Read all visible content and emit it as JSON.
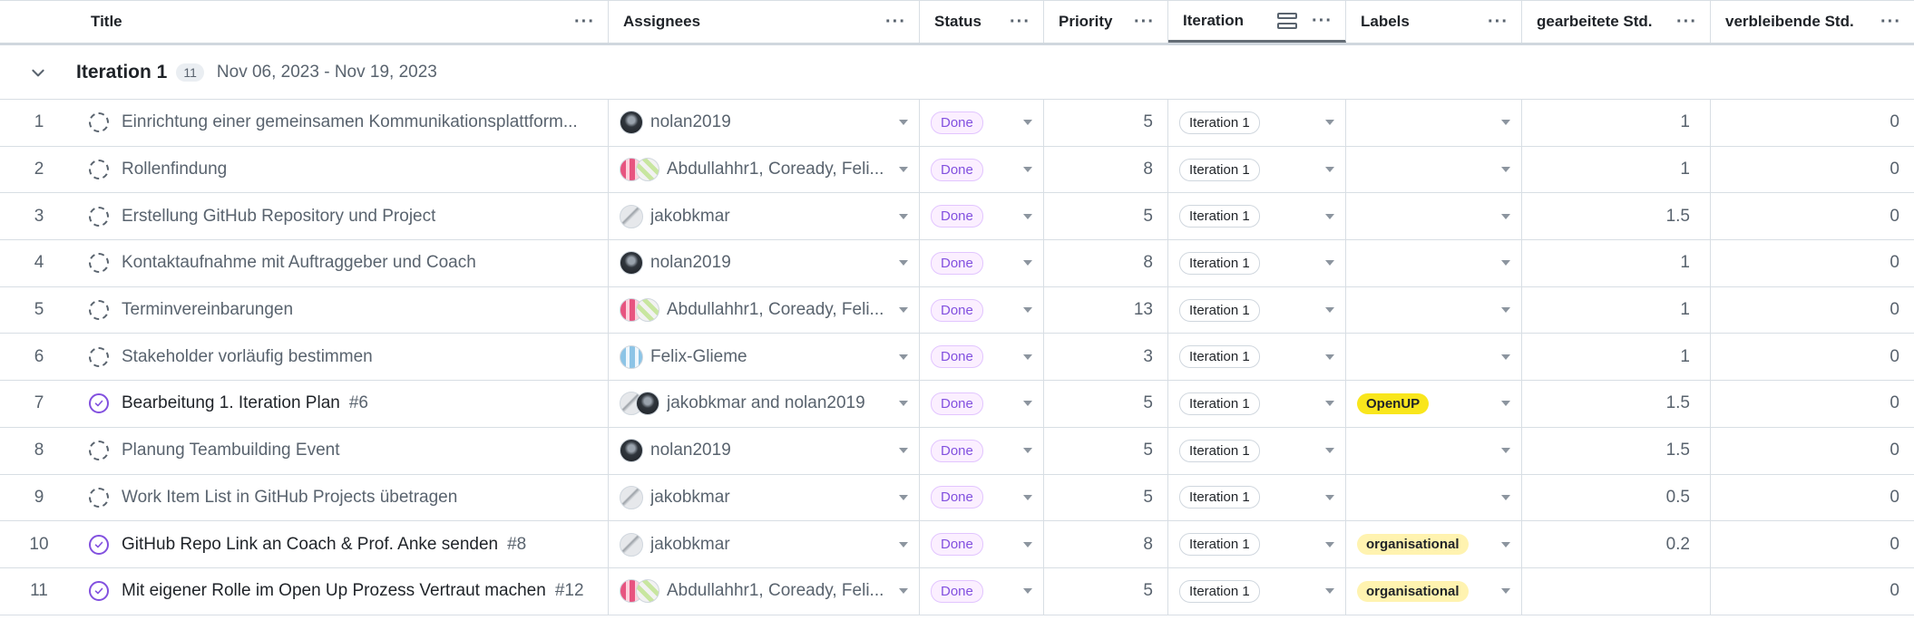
{
  "columns": [
    {
      "key": "title",
      "label": "Title"
    },
    {
      "key": "assignees",
      "label": "Assignees"
    },
    {
      "key": "status",
      "label": "Status"
    },
    {
      "key": "priority",
      "label": "Priority"
    },
    {
      "key": "iteration",
      "label": "Iteration"
    },
    {
      "key": "labels",
      "label": "Labels"
    },
    {
      "key": "gearbeitete",
      "label": "gearbeitete Std."
    },
    {
      "key": "verbleibende",
      "label": "verbleibende Std."
    }
  ],
  "group": {
    "title": "Iteration 1",
    "count": "11",
    "dates": "Nov 06, 2023 - Nov 19, 2023"
  },
  "colors": {
    "done_text": "#8250df",
    "done_bg": "#fbefff",
    "label_openup": "#f9e61c",
    "label_organisational": "#fff3b0"
  },
  "rows": [
    {
      "num": "1",
      "type": "draft",
      "title": "Einrichtung einer gemeinsamen Kommunikationsplattform...",
      "issue_num": "",
      "avatars": [
        "dark"
      ],
      "assignees": "nolan2019",
      "status": "Done",
      "priority": "5",
      "iteration": "Iteration 1",
      "label": "",
      "label_color": "",
      "gearbeitete": "1",
      "verbleibende": "0"
    },
    {
      "num": "2",
      "type": "draft",
      "title": "Rollenfindung",
      "issue_num": "",
      "avatars": [
        "pink",
        "green"
      ],
      "assignees": "Abdullahhr1, Coready, Feli...",
      "status": "Done",
      "priority": "8",
      "iteration": "Iteration 1",
      "label": "",
      "label_color": "",
      "gearbeitete": "1",
      "verbleibende": "0"
    },
    {
      "num": "3",
      "type": "draft",
      "title": "Erstellung GitHub Repository und Project",
      "issue_num": "",
      "avatars": [
        "gray"
      ],
      "assignees": "jakobkmar",
      "status": "Done",
      "priority": "5",
      "iteration": "Iteration 1",
      "label": "",
      "label_color": "",
      "gearbeitete": "1.5",
      "verbleibende": "0"
    },
    {
      "num": "4",
      "type": "draft",
      "title": "Kontaktaufnahme mit Auftraggeber und Coach",
      "issue_num": "",
      "avatars": [
        "dark"
      ],
      "assignees": "nolan2019",
      "status": "Done",
      "priority": "8",
      "iteration": "Iteration 1",
      "label": "",
      "label_color": "",
      "gearbeitete": "1",
      "verbleibende": "0"
    },
    {
      "num": "5",
      "type": "draft",
      "title": "Terminvereinbarungen",
      "issue_num": "",
      "avatars": [
        "pink",
        "green"
      ],
      "assignees": "Abdullahhr1, Coready, Feli...",
      "status": "Done",
      "priority": "13",
      "iteration": "Iteration 1",
      "label": "",
      "label_color": "",
      "gearbeitete": "1",
      "verbleibende": "0"
    },
    {
      "num": "6",
      "type": "draft",
      "title": "Stakeholder vorläufig bestimmen",
      "issue_num": "",
      "avatars": [
        "blue"
      ],
      "assignees": "Felix-Glieme",
      "status": "Done",
      "priority": "3",
      "iteration": "Iteration 1",
      "label": "",
      "label_color": "",
      "gearbeitete": "1",
      "verbleibende": "0"
    },
    {
      "num": "7",
      "type": "issue",
      "title": "Bearbeitung 1. Iteration Plan",
      "issue_num": "#6",
      "avatars": [
        "gray",
        "dark"
      ],
      "assignees": "jakobkmar and nolan2019",
      "status": "Done",
      "priority": "5",
      "iteration": "Iteration 1",
      "label": "OpenUP",
      "label_color": "#f9e61c",
      "gearbeitete": "1.5",
      "verbleibende": "0"
    },
    {
      "num": "8",
      "type": "draft",
      "title": "Planung Teambuilding Event",
      "issue_num": "",
      "avatars": [
        "dark"
      ],
      "assignees": "nolan2019",
      "status": "Done",
      "priority": "5",
      "iteration": "Iteration 1",
      "label": "",
      "label_color": "",
      "gearbeitete": "1.5",
      "verbleibende": "0"
    },
    {
      "num": "9",
      "type": "draft",
      "title": "Work Item List in GitHub Projects übetragen",
      "issue_num": "",
      "avatars": [
        "gray"
      ],
      "assignees": "jakobkmar",
      "status": "Done",
      "priority": "5",
      "iteration": "Iteration 1",
      "label": "",
      "label_color": "",
      "gearbeitete": "0.5",
      "verbleibende": "0"
    },
    {
      "num": "10",
      "type": "issue",
      "title": "GitHub Repo Link an Coach & Prof. Anke senden",
      "issue_num": "#8",
      "avatars": [
        "gray"
      ],
      "assignees": "jakobkmar",
      "status": "Done",
      "priority": "8",
      "iteration": "Iteration 1",
      "label": "organisational",
      "label_color": "#fff3b0",
      "gearbeitete": "0.2",
      "verbleibende": "0"
    },
    {
      "num": "11",
      "type": "issue",
      "title": "Mit eigener Rolle im Open Up Prozess Vertraut machen",
      "issue_num": "#12",
      "avatars": [
        "pink",
        "green"
      ],
      "assignees": "Abdullahhr1, Coready, Feli...",
      "status": "Done",
      "priority": "5",
      "iteration": "Iteration 1",
      "label": "organisational",
      "label_color": "#fff3b0",
      "gearbeitete": "",
      "verbleibende": "0"
    }
  ]
}
